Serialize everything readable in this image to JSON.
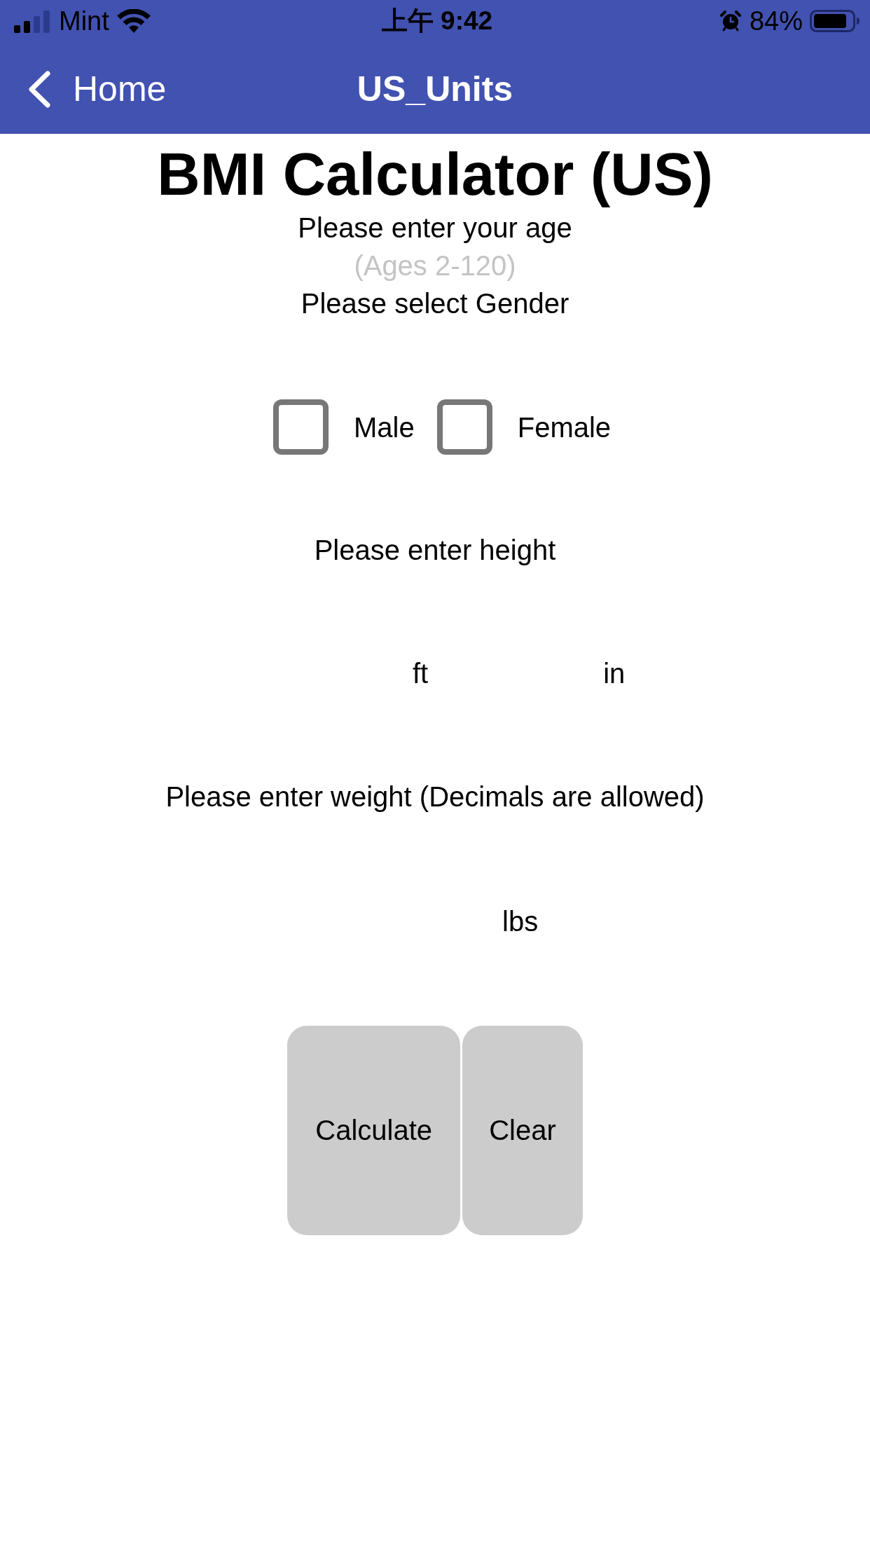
{
  "status_bar": {
    "carrier": "Mint",
    "time": "上午 9:42",
    "battery": "84%"
  },
  "nav_bar": {
    "back_label": "Home",
    "title": "US_Units"
  },
  "heading": "BMI Calculator (US)",
  "age": {
    "label": "Please enter your age",
    "placeholder": "(Ages 2-120)"
  },
  "gender": {
    "label": "Please select Gender",
    "options": [
      {
        "label": "Male",
        "checked": false
      },
      {
        "label": "Female",
        "checked": false
      }
    ]
  },
  "height": {
    "label": "Please enter height",
    "units": [
      "ft",
      "in"
    ]
  },
  "weight": {
    "label": "Please enter weight (Decimals are allowed)",
    "unit": "lbs"
  },
  "buttons": [
    "Calculate",
    "Clear"
  ]
}
